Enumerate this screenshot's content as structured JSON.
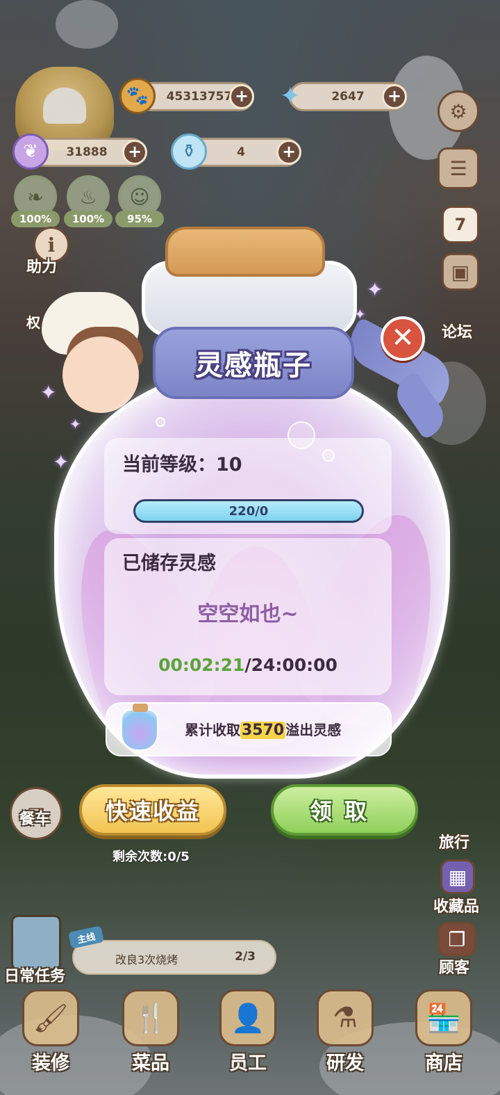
{
  "hud": {
    "coins": "45313757",
    "gems": "2647",
    "inspiration_feathers": "31888",
    "potions": "4",
    "stats": [
      "100%",
      "100%",
      "95%"
    ]
  },
  "left_side": {
    "assist_label": "助力",
    "cut_label": "权"
  },
  "right_side": {
    "forum_label": "论坛",
    "calendar_day": "7",
    "travel_label": "旅行",
    "collection_label": "收藏品",
    "customers_label": "顾客"
  },
  "dialog": {
    "title": "灵感瓶子",
    "close_symbol": "✕",
    "level_text": "当前等级：10",
    "progress_label": "220/0",
    "progress_fraction": 1.0,
    "stored_title": "已储存灵感",
    "stored_empty": "空空如也~",
    "timer_elapsed": "00:02:21",
    "timer_total": "/24:00:00",
    "collect_prefix": "累计收取",
    "collect_amount": "3570",
    "collect_suffix": "溢出灵感"
  },
  "actions": {
    "fast_label": "快速收益",
    "claim_label": "领取",
    "remaining_label": "剩余次数:0/5"
  },
  "bottom": {
    "dining_car_label": "餐车",
    "daily_tasks_label": "日常任务",
    "quest_tag": "主线",
    "quest_name": "改良3次烧烤",
    "quest_progress": "2/3",
    "nav": [
      {
        "label": "装修",
        "icon": "renovate-icon"
      },
      {
        "label": "菜品",
        "icon": "dishes-icon"
      },
      {
        "label": "员工",
        "icon": "staff-icon"
      },
      {
        "label": "研发",
        "icon": "research-icon"
      },
      {
        "label": "商店",
        "icon": "shop-icon"
      }
    ]
  },
  "colors": {
    "ribbon": "#8a91d2",
    "close": "#d9543f",
    "fast_button": "#f2c451",
    "claim_button": "#8fd05a",
    "timer_elapsed": "#5aa43a",
    "stored_empty": "#8d5fa3"
  }
}
